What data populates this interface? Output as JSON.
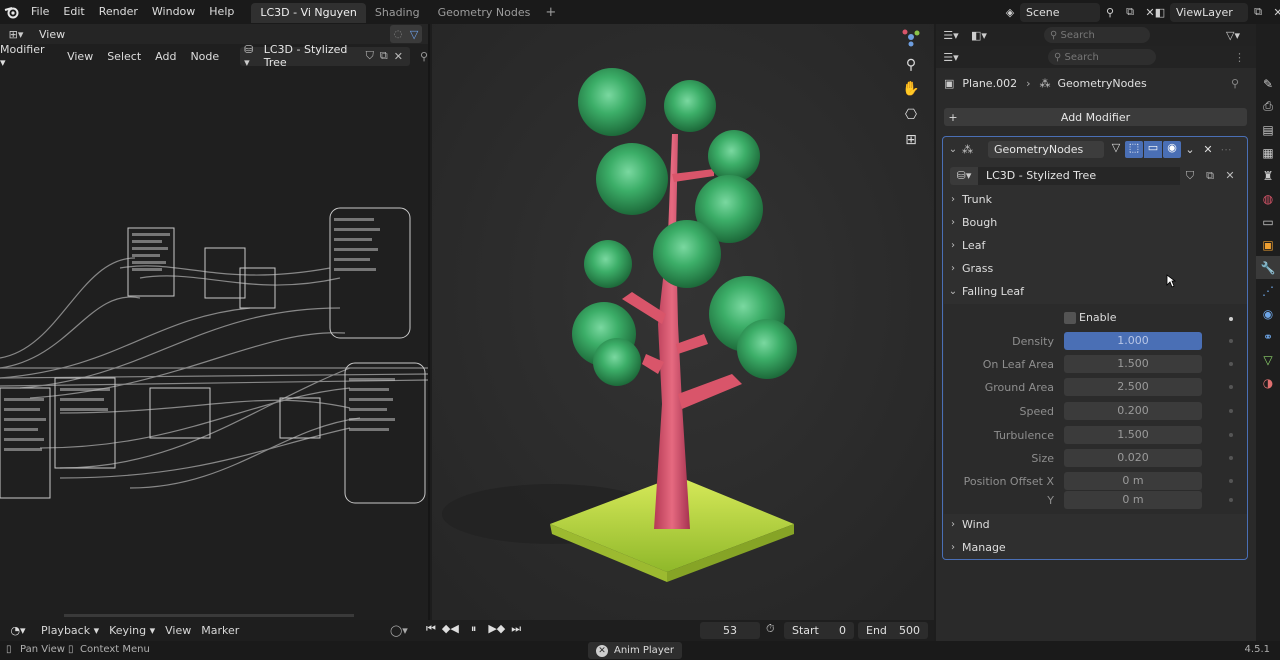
{
  "topbar": {
    "menus": [
      "File",
      "Edit",
      "Render",
      "Window",
      "Help"
    ],
    "workspaces": [
      {
        "label": "LC3D - Vi Nguyen",
        "active": true
      },
      {
        "label": "Shading",
        "active": false
      },
      {
        "label": "Geometry Nodes",
        "active": false
      }
    ],
    "scene": "Scene",
    "view_layer": "ViewLayer"
  },
  "node_editor": {
    "view_menu": "View",
    "menus": [
      "View",
      "Select",
      "Add",
      "Node"
    ],
    "context": "Modifier",
    "node_group": "LC3D - Stylized Tree"
  },
  "properties": {
    "search_placeholder": "Search",
    "breadcrumb": {
      "object": "Plane.002",
      "modifier": "GeometryNodes"
    },
    "add_modifier": "Add Modifier",
    "modifier_name": "GeometryNodes",
    "node_group": "LC3D - Stylized Tree",
    "panels_top": [
      "Trunk",
      "Bough",
      "Leaf",
      "Grass"
    ],
    "falling_leaf": {
      "title": "Falling Leaf",
      "enable_label": "Enable",
      "fields": [
        {
          "label": "Density",
          "value": "1.000",
          "selected": true
        },
        {
          "label": "On Leaf Area",
          "value": "1.500"
        },
        {
          "label": "Ground Area",
          "value": "2.500"
        },
        {
          "label": "Speed",
          "value": "0.200"
        },
        {
          "label": "Turbulence",
          "value": "1.500"
        },
        {
          "label": "Size",
          "value": "0.020"
        },
        {
          "label": "Position Offset X",
          "value": "0 m"
        },
        {
          "label": "Y",
          "value": "0 m"
        }
      ]
    },
    "panels_bottom": [
      "Wind",
      "Manage"
    ]
  },
  "timeline": {
    "menus": [
      "Playback",
      "Keying",
      "View",
      "Marker"
    ],
    "current_frame": "53",
    "start_label": "Start",
    "start_value": "0",
    "end_label": "End",
    "end_value": "500"
  },
  "statusbar": {
    "pan_view": "Pan View",
    "context_menu": "Context Menu",
    "anim_player": "Anim Player",
    "version": "4.5.1"
  },
  "colors": {
    "accent_blue": "#4a6fb5",
    "trunk_pink": "#d9556a",
    "leaf_green": "#3da860",
    "grass_yellow": "#b5d43a"
  }
}
